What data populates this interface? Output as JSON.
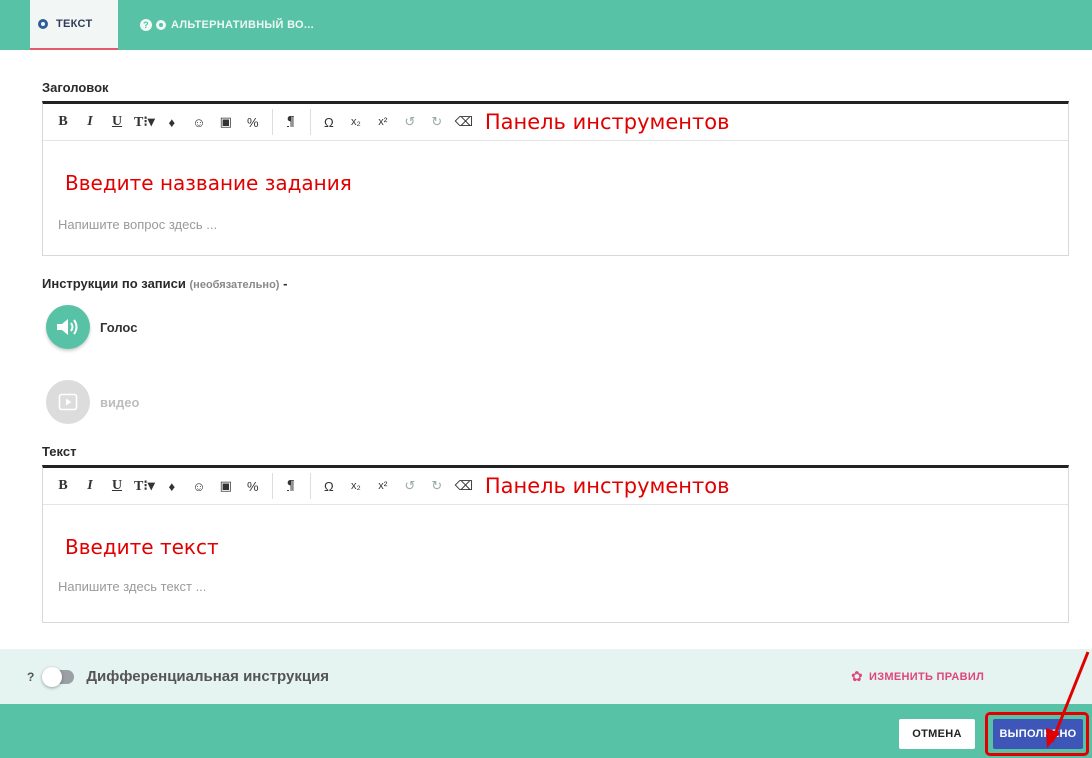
{
  "tabs": [
    {
      "label": "ТЕКСТ"
    },
    {
      "label": "АЛЬТЕРНАТИВНЫЙ ВО...",
      "help": "?"
    }
  ],
  "heading_section": {
    "label": "Заголовок",
    "toolbar_callout": "Панель инструментов",
    "body_callout": "Введите название задания",
    "placeholder": "Напишите вопрос здесь ..."
  },
  "toolbar_buttons": [
    "B",
    "I",
    "U",
    "T⁝▾",
    "♦",
    "☺",
    "▣",
    "%",
    "¶",
    "Ω",
    "x₂",
    "x²",
    "↺",
    "↻",
    "⌫"
  ],
  "instructions": {
    "label": "Инструкции по записи",
    "optional": "(необязательно)",
    "dash": "-",
    "voice": "Голос",
    "video": "видео"
  },
  "text_section": {
    "label": "Текст",
    "toolbar_callout": "Панель инструментов",
    "body_callout": "Введите текст",
    "placeholder": "Напишите здесь текст ..."
  },
  "differential": {
    "help": "?",
    "label": "Дифференциальная инструкция",
    "enabled": false,
    "change_rules": "ИЗМЕНИТЬ ПРАВИЛ"
  },
  "footer": {
    "cancel": "ОТМЕНА",
    "done": "ВЫПОЛНЕНО"
  },
  "colors": {
    "teal": "#57c2a6",
    "done_blue": "#3e56b7",
    "annotation_red": "#e00000",
    "rules_pink": "#e0457b"
  }
}
